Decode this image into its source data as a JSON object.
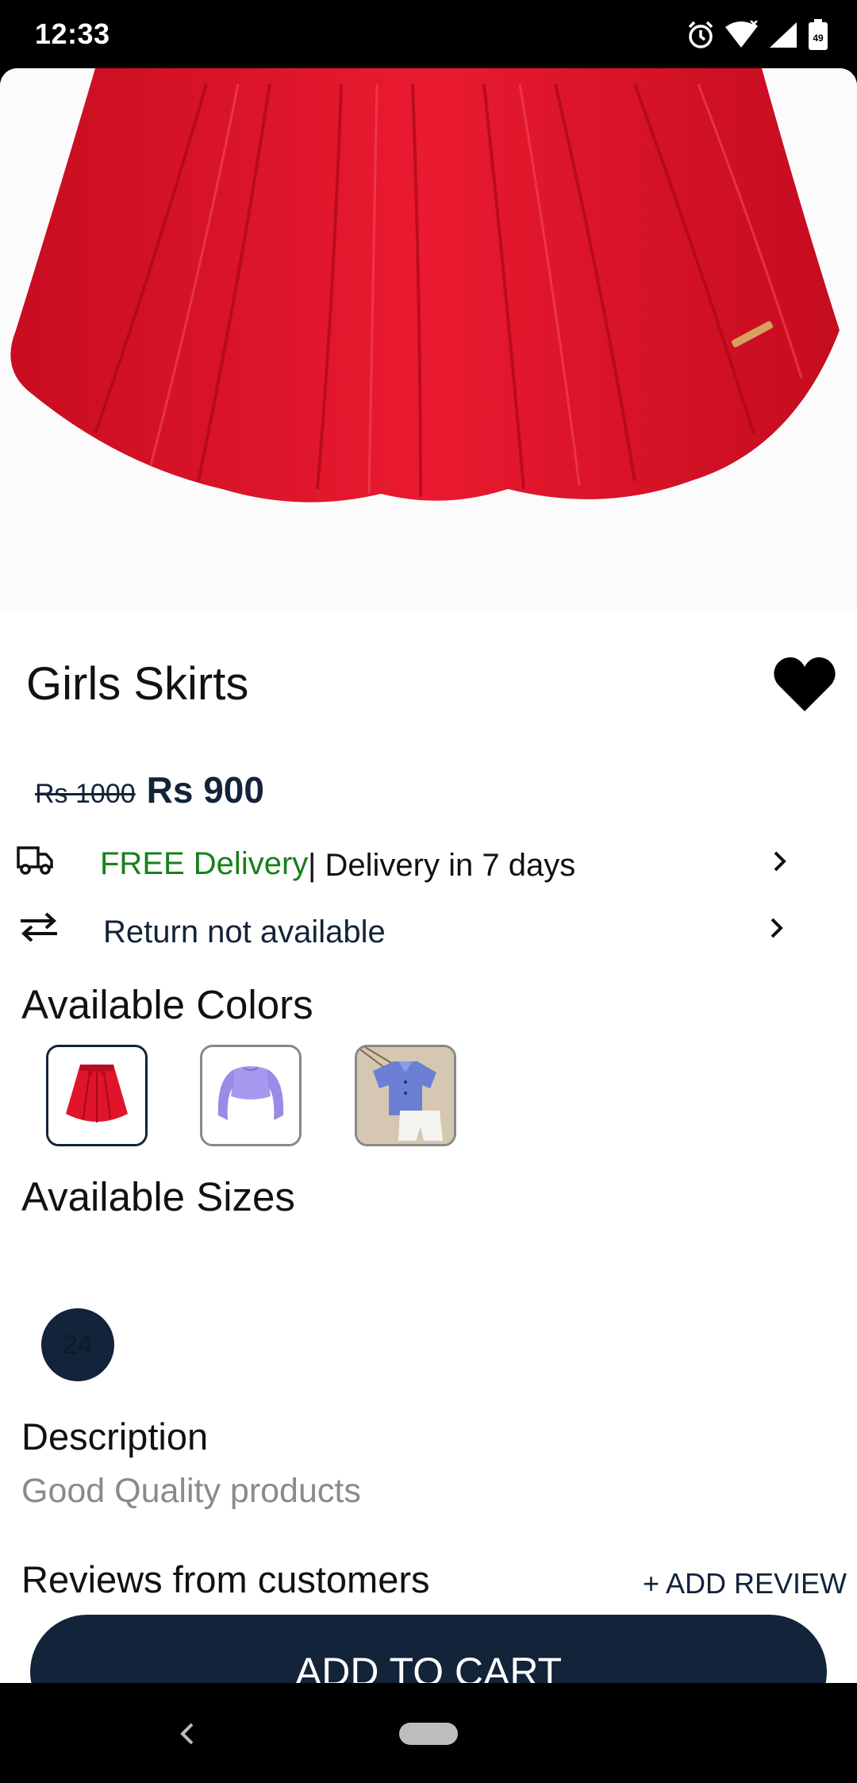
{
  "status_bar": {
    "time": "12:33",
    "battery_level": "49",
    "icons": [
      "alarm-icon",
      "wifi-icon",
      "cell-signal-icon",
      "battery-icon"
    ]
  },
  "product": {
    "title": "Girls Skirts",
    "old_price": "Rs 1000",
    "price": "Rs 900",
    "favorited": true
  },
  "delivery": {
    "free_label": "FREE Delivery",
    "time_label": "| Delivery in 7 days",
    "icon": "truck-icon"
  },
  "returns": {
    "label": "Return not available",
    "icon": "swap-arrows-icon"
  },
  "colors": {
    "heading": "Available Colors",
    "swatches": [
      {
        "name": "red skirt",
        "selected": true
      },
      {
        "name": "lavender top",
        "selected": false
      },
      {
        "name": "blue shirt set",
        "selected": false
      }
    ]
  },
  "sizes": {
    "heading": "Available Sizes",
    "options": [
      "24"
    ]
  },
  "description": {
    "heading": "Description",
    "text": "Good Quality products"
  },
  "reviews": {
    "heading": "Reviews from customers",
    "add_label": "+ ADD REVIEW"
  },
  "cart_button": "ADD TO CART",
  "theme": {
    "primary": "#12233a",
    "delivery_green": "#188019",
    "skirt_red": "#e0142a"
  }
}
